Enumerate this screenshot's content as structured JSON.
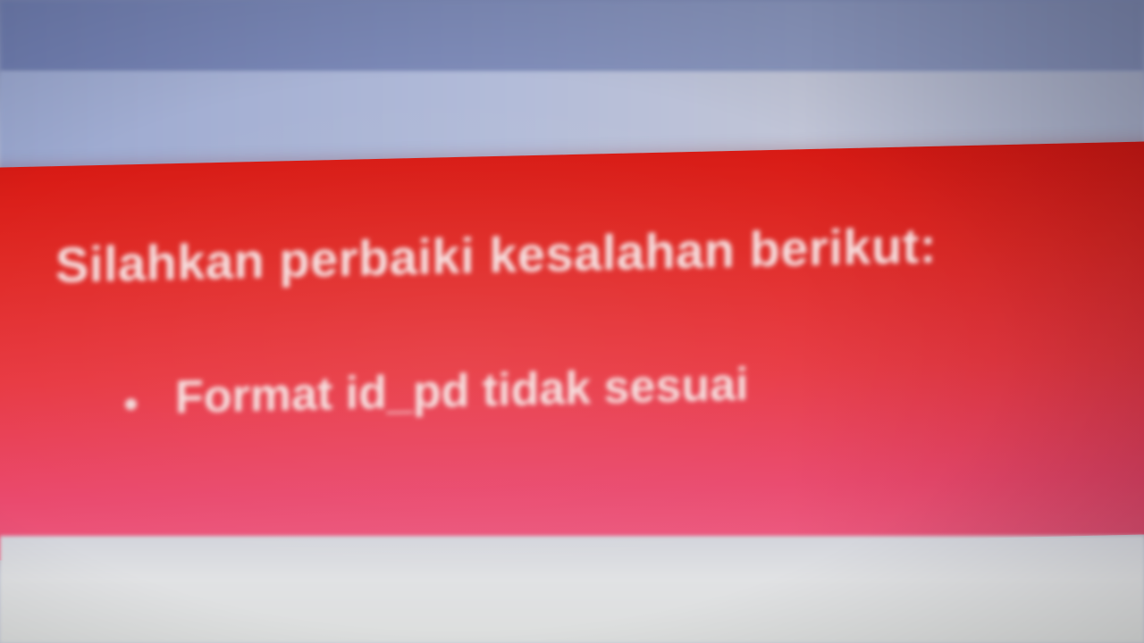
{
  "alert": {
    "title": "Silahkan perbaiki kesalahan berikut:",
    "errors": [
      "Format id_pd tidak sesuai"
    ],
    "colors": {
      "background": "#e02a26",
      "text": "#f6dede"
    }
  },
  "icons": {
    "bullet": "bullet-dot"
  }
}
